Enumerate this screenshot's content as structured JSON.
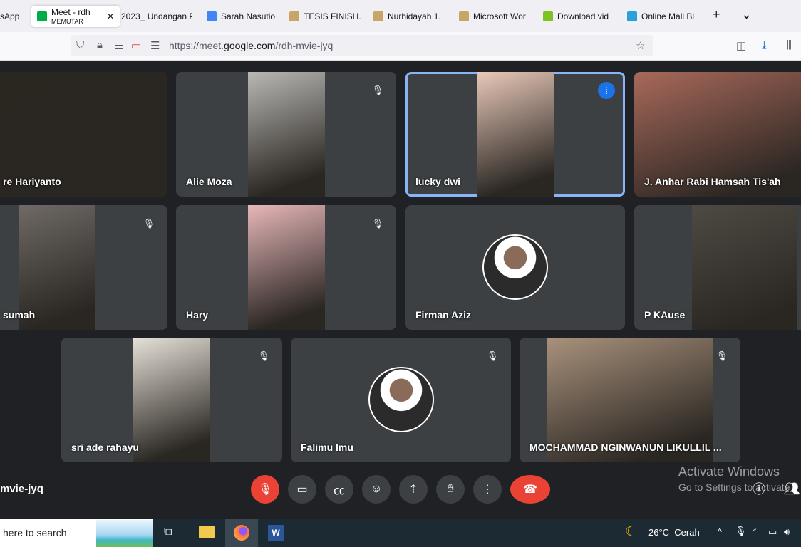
{
  "browser": {
    "tabs": [
      {
        "label": "sApp",
        "icon": "whatsapp-icon"
      },
      {
        "label": "Meet - rdh",
        "sublabel": "MEMUTAR",
        "icon": "google-meet-icon",
        "active": true
      },
      {
        "label": "2023_ Undangan P",
        "icon": "document-icon"
      },
      {
        "label": "Sarah Nasutio",
        "icon": "google-icon"
      },
      {
        "label": "TESIS FINISH.p",
        "icon": "image-icon"
      },
      {
        "label": "Nurhidayah 1.",
        "icon": "image-icon"
      },
      {
        "label": "Microsoft Wor",
        "icon": "image-icon"
      },
      {
        "label": "Download vid",
        "icon": "download-icon"
      },
      {
        "label": "Online Mall Bl",
        "icon": "shop-icon"
      }
    ],
    "new_tab": "+",
    "tab_list": "⌄",
    "url_prefix": "https://meet.",
    "url_domain": "google.com",
    "url_path": "/rdh-mvie-jyq"
  },
  "meeting": {
    "code": "mvie-jyq",
    "tiles": [
      {
        "name": "re Hariyanto",
        "muted": false,
        "video": "full",
        "color": "#2a2620"
      },
      {
        "name": "Alie Moza",
        "muted": true,
        "video": "center",
        "color": "#b9b8b4"
      },
      {
        "name": "lucky dwi",
        "muted": false,
        "speaking": true,
        "video": "center",
        "color": "#e9c9b9"
      },
      {
        "name": "J. Anhar Rabi Hamsah Tis'ah",
        "muted": false,
        "video": "full",
        "color": "#a8695a"
      },
      {
        "name": "sumah",
        "muted": true,
        "video": "left",
        "color": "#6f6a66"
      },
      {
        "name": "Hary",
        "muted": true,
        "video": "center",
        "color": "#e7b7b9"
      },
      {
        "name": "Firman Aziz",
        "muted": false,
        "video": "avatar"
      },
      {
        "name": "P KAuse",
        "muted": false,
        "video": "right",
        "color": "#4e4a43"
      },
      {
        "name": "sri ade rahayu",
        "muted": true,
        "video": "center",
        "color": "#e7e2d8"
      },
      {
        "name": "Falimu Imu",
        "muted": true,
        "video": "avatar"
      },
      {
        "name": "MOCHAMMAD NGINWANUN LIKULLIL ...",
        "muted": true,
        "video": "wide",
        "color": "#a9927c"
      }
    ],
    "controls": [
      "microphone-off",
      "camera",
      "captions",
      "emoji",
      "present",
      "raise-hand",
      "more-options",
      "leave-call"
    ]
  },
  "watermark": {
    "title": "Activate Windows",
    "subtitle": "Go to Settings to activate"
  },
  "taskbar": {
    "search": "here to search",
    "weather": "26°C  Cerah"
  },
  "colors": {
    "accent": "#8ab4f8",
    "danger": "#ea4335",
    "tile": "#3c4043"
  }
}
